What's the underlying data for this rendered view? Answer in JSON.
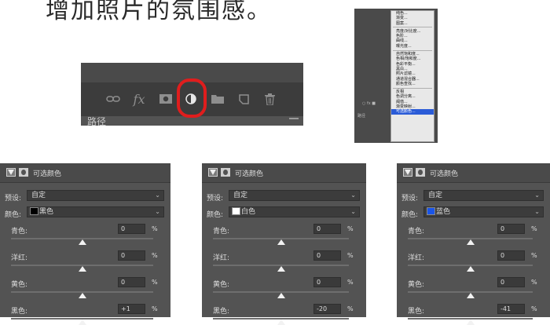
{
  "heading": "增加照片的氛围感。",
  "layers_panel": {
    "tab_label": "路径",
    "toolbar": [
      "link-icon",
      "fx-icon",
      "mask-icon",
      "adjustment-layer-icon",
      "folder-icon",
      "new-layer-icon",
      "trash-icon"
    ],
    "fx_label": "fx"
  },
  "adjustment_menu": {
    "items_group1": [
      "纯色...",
      "渐变...",
      "图案..."
    ],
    "items_group2": [
      "亮度/对比度...",
      "色阶...",
      "曲线...",
      "曝光度..."
    ],
    "items_group3": [
      "自然饱和度...",
      "色相/饱和度...",
      "色彩平衡...",
      "黑白...",
      "照片滤镜...",
      "通道混合器...",
      "颜色查找..."
    ],
    "items_group4": [
      "反相",
      "色调分离...",
      "阈值...",
      "渐变映射...",
      "可选颜色..."
    ],
    "selected": "可选颜色...",
    "side_label": "路径"
  },
  "panels": [
    {
      "title": "可选颜色",
      "preset_label": "预设:",
      "preset_value": "自定",
      "colors_label": "颜色:",
      "color_value": "黑色",
      "swatch": "#000000",
      "sliders": [
        {
          "label": "青色:",
          "value": "0",
          "level": 0.5
        },
        {
          "label": "洋红:",
          "value": "0",
          "level": 0.5
        },
        {
          "label": "黄色:",
          "value": "0",
          "level": 0.5
        },
        {
          "label": "黑色:",
          "value": "+1",
          "level": 0.5
        }
      ],
      "pct": "%"
    },
    {
      "title": "可选颜色",
      "preset_label": "预设:",
      "preset_value": "自定",
      "colors_label": "颜色:",
      "color_value": "白色",
      "swatch": "#ffffff",
      "sliders": [
        {
          "label": "青色:",
          "value": "0",
          "level": 0.5
        },
        {
          "label": "洋红:",
          "value": "0",
          "level": 0.5
        },
        {
          "label": "黄色:",
          "value": "0",
          "level": 0.5
        },
        {
          "label": "黑色:",
          "value": "-20",
          "level": 0.5
        }
      ],
      "pct": "%"
    },
    {
      "title": "可选颜色",
      "preset_label": "预设:",
      "preset_value": "自定",
      "colors_label": "颜色:",
      "color_value": "蓝色",
      "swatch": "#1a55e8",
      "sliders": [
        {
          "label": "青色:",
          "value": "0",
          "level": 0.5
        },
        {
          "label": "洋红:",
          "value": "0",
          "level": 0.5
        },
        {
          "label": "黄色:",
          "value": "0",
          "level": 0.5
        },
        {
          "label": "黑色:",
          "value": "-41",
          "level": 0.5
        }
      ],
      "pct": "%"
    }
  ],
  "colors": {
    "highlight_ring": "#e01d1d",
    "panel_bg": "#535353",
    "menu_selected": "#2a5bd7"
  }
}
